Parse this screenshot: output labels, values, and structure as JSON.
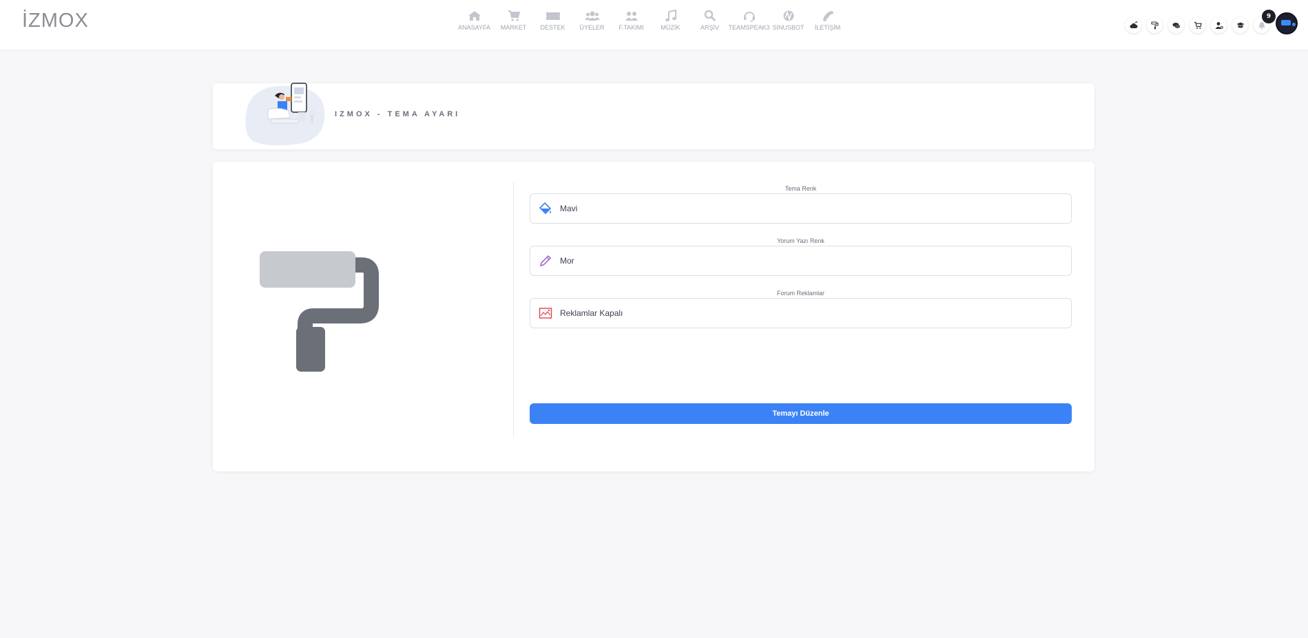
{
  "header": {
    "logo": "İZMOX",
    "nav": [
      {
        "label": "ANASAYFA",
        "icon": "home-icon"
      },
      {
        "label": "MARKET",
        "icon": "cart-icon"
      },
      {
        "label": "DESTEK",
        "icon": "ticket-icon"
      },
      {
        "label": "ÜYELER",
        "icon": "users-icon"
      },
      {
        "label": "F.TAKIMI",
        "icon": "team-icon"
      },
      {
        "label": "MÜZİK",
        "icon": "music-icon"
      },
      {
        "label": "ARŞİV",
        "icon": "search-icon"
      },
      {
        "label": "TEAMSPEAK3",
        "icon": "headset-icon"
      },
      {
        "label": "SINUSBOT",
        "icon": "sinusbot-icon"
      },
      {
        "label": "İLETİŞİM",
        "icon": "phone-icon"
      }
    ],
    "right_icons": [
      "cloud-upload-icon",
      "paint-roller-icon",
      "chat-icon",
      "cart-icon",
      "user-settings-icon",
      "graduation-cap-icon",
      "bell-icon"
    ],
    "notification_count": "9"
  },
  "page": {
    "title": "IZMOX - TEMA AYARI"
  },
  "form": {
    "fields": [
      {
        "label": "Tema Renk",
        "value": "Mavi",
        "icon": "paint-bucket-icon",
        "icon_color": "#3b82f6"
      },
      {
        "label": "Yorum Yazı Renk",
        "value": "Mor",
        "icon": "pencil-icon",
        "icon_color": "#9b59d0"
      },
      {
        "label": "Forum Reklamlar",
        "value": "Reklamlar Kapalı",
        "icon": "image-icon",
        "icon_color": "#e0444c"
      }
    ],
    "submit_label": "Temayı Düzenle"
  },
  "colors": {
    "accent": "#3b82f6",
    "background": "#f7f7f9"
  }
}
